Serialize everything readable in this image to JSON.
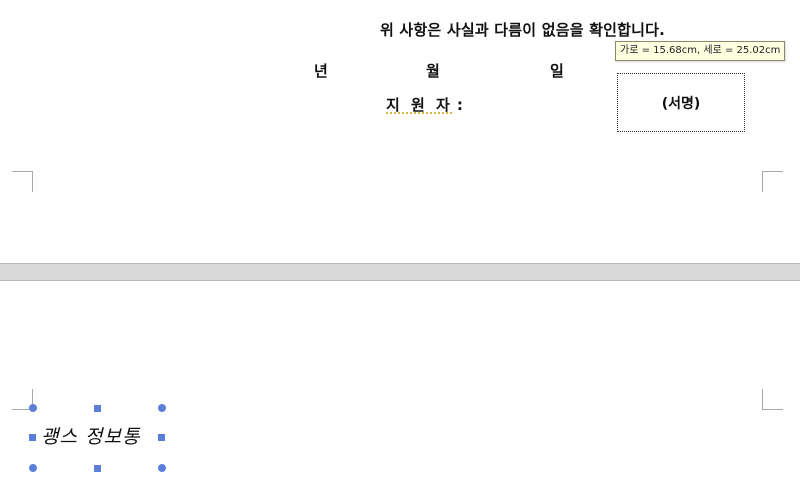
{
  "document": {
    "declaration": "위 사항은 사실과 다름이 없음을 확인합니다.",
    "date": {
      "year_label": "년",
      "month_label": "월",
      "day_label": "일"
    },
    "applicant": {
      "label": "지 원 자",
      "colon": ":"
    },
    "signature_box_label": "(서명)"
  },
  "tooltip": {
    "text": "가로 = 15.68cm, 세로 = 25.02cm"
  },
  "selected_object": {
    "text": "괭스 정보통"
  },
  "colors": {
    "page": "#ffffff",
    "page_gap": "#d9d9d9",
    "handle": "#5b7fd8",
    "tooltip_bg": "#ffffe1",
    "dotted_underline": "#c8a000"
  }
}
